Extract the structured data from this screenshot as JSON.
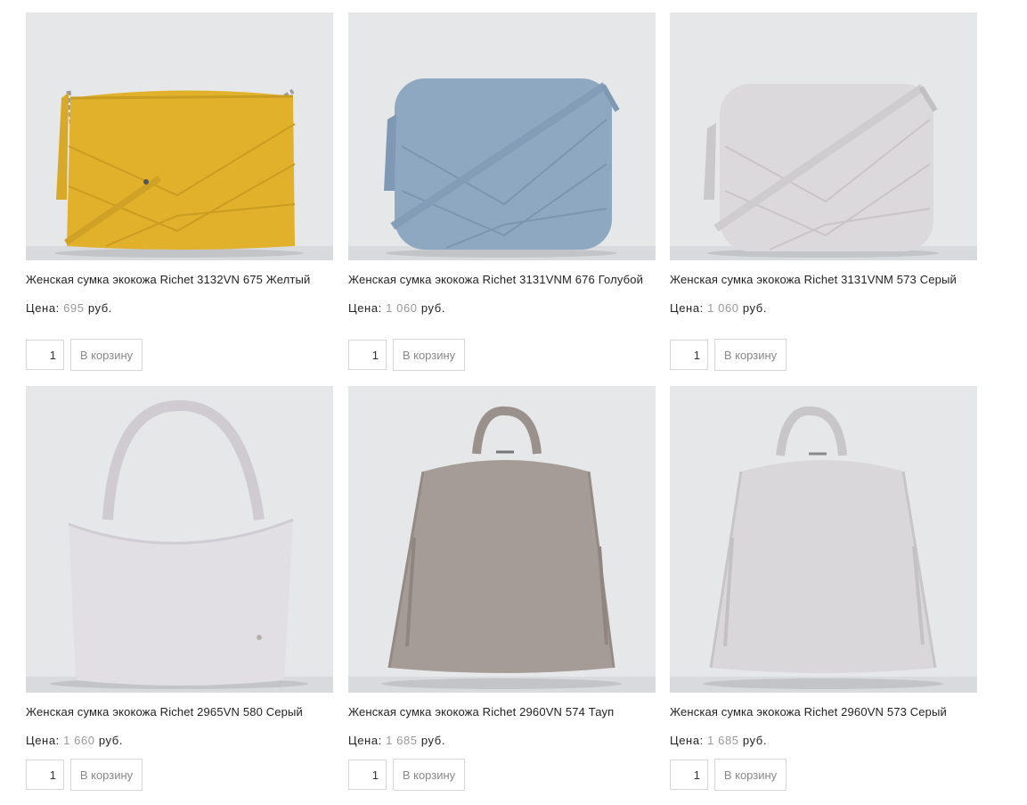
{
  "catalog": {
    "price_label": "Цена:",
    "currency": "руб.",
    "cart_button_label": "В корзину",
    "products": [
      {
        "title": "Женская сумка экокожа Richet 3132VN 675 Желтый",
        "price": "695",
        "quantity": "1",
        "image": "yellow-quilted-crossbody-bag",
        "color": "#e2b12c"
      },
      {
        "title": "Женская сумка экокожа Richet 3131VNM 676 Голубой",
        "price": "1 060",
        "quantity": "1",
        "image": "blue-quilted-camera-bag",
        "color": "#8fa8c2"
      },
      {
        "title": "Женская сумка экокожа Richet 3131VNM 573 Серый",
        "price": "1 060",
        "quantity": "1",
        "image": "grey-quilted-camera-bag",
        "color": "#dcd9dc"
      },
      {
        "title": "Женская сумка экокожа Richet 2965VN 580 Серый",
        "price": "1 660",
        "quantity": "1",
        "image": "grey-tote-bag",
        "color": "#e1dfe3"
      },
      {
        "title": "Женская сумка экокожа Richet 2960VN 574 Тауп",
        "price": "1 685",
        "quantity": "1",
        "image": "taupe-backpack",
        "color": "#a59b97"
      },
      {
        "title": "Женская сумка экокожа Richet 2960VN 573 Серый",
        "price": "1 685",
        "quantity": "1",
        "image": "grey-backpack",
        "color": "#dad7da"
      }
    ]
  }
}
